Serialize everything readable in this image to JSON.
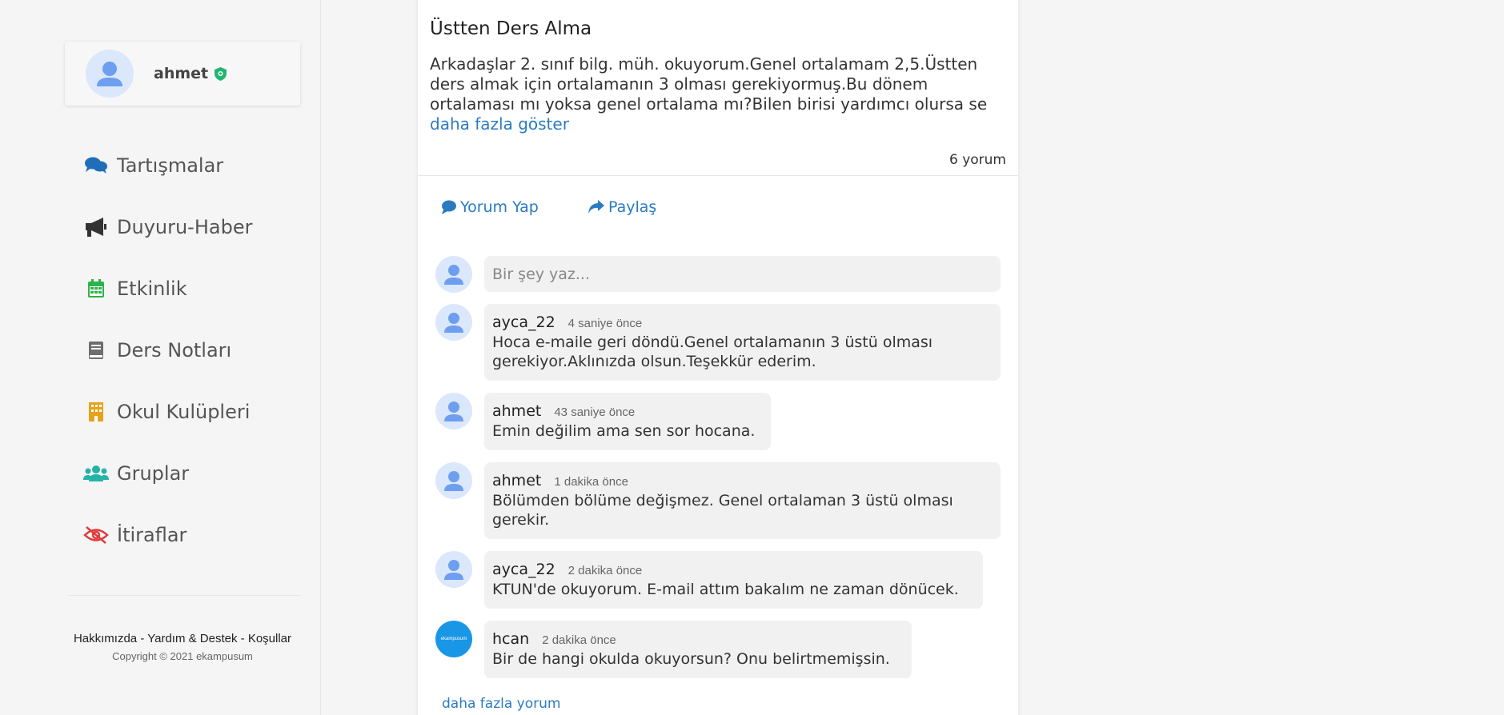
{
  "sidebar": {
    "profile": {
      "name": "ahmet",
      "avatar_icon": "user-avatar-icon",
      "badge_icon": "verified-shield-icon"
    },
    "items": [
      {
        "label": "Tartışmalar",
        "icon": "comments-icon",
        "color": "#1e6fb8"
      },
      {
        "label": "Duyuru-Haber",
        "icon": "megaphone-icon",
        "color": "#333333"
      },
      {
        "label": "Etkinlik",
        "icon": "calendar-icon",
        "color": "#2bb34a"
      },
      {
        "label": "Ders Notları",
        "icon": "book-icon",
        "color": "#6d6d6d"
      },
      {
        "label": "Okul Kulüpleri",
        "icon": "building-icon",
        "color": "#e6a31a"
      },
      {
        "label": "Gruplar",
        "icon": "users-icon",
        "color": "#24b3a8"
      },
      {
        "label": "İtiraflar",
        "icon": "eye-slash-icon",
        "color": "#e03a3a"
      }
    ],
    "footer": {
      "about": "Hakkımızda",
      "help": "Yardım & Destek",
      "terms": "Koşullar",
      "sep": " - ",
      "copyright": "Copyright © 2021 ekampusum"
    }
  },
  "post": {
    "title": "Üstten Ders Alma",
    "body": "Arkadaşlar 2. sınıf bilg. müh. okuyorum.Genel ortalamam 2,5.Üstten ders almak için ortalamanın 3 olması gerekiyormuş.Bu dönem ortalaması mı yoksa genel ortalama mı?Bilen birisi yardımcı olursa se ",
    "more_label": "daha fazla göster",
    "comment_count": "6 yorum",
    "actions": {
      "comment": "Yorum Yap",
      "share": "Paylaş"
    },
    "compose_placeholder": "Bir şey yaz...",
    "comments": [
      {
        "author": "ayca_22",
        "time": "4 saniye önce",
        "text": "Hoca e-maile geri döndü.Genel ortalamanın 3 üstü olması gerekiyor.Aklınızda olsun.Teşekkür ederim."
      },
      {
        "author": "ahmet",
        "time": "43 saniye önce",
        "text": "Emin değilim ama sen sor hocana."
      },
      {
        "author": "ahmet",
        "time": "1 dakika önce",
        "text": "Bölümden bölüme değişmez. Genel ortalaman 3 üstü olması gerekir."
      },
      {
        "author": "ayca_22",
        "time": "2 dakika önce",
        "text": "KTUN'de okuyorum. E-mail attım bakalım ne zaman dönücek."
      },
      {
        "author": "hcan",
        "time": "2 dakika önce",
        "text": "Bir de hangi okulda okuyorsun? Onu belirtmemişsin.",
        "avatar_text": "ekampusum"
      }
    ],
    "more_comments": "daha fazla yorum"
  }
}
